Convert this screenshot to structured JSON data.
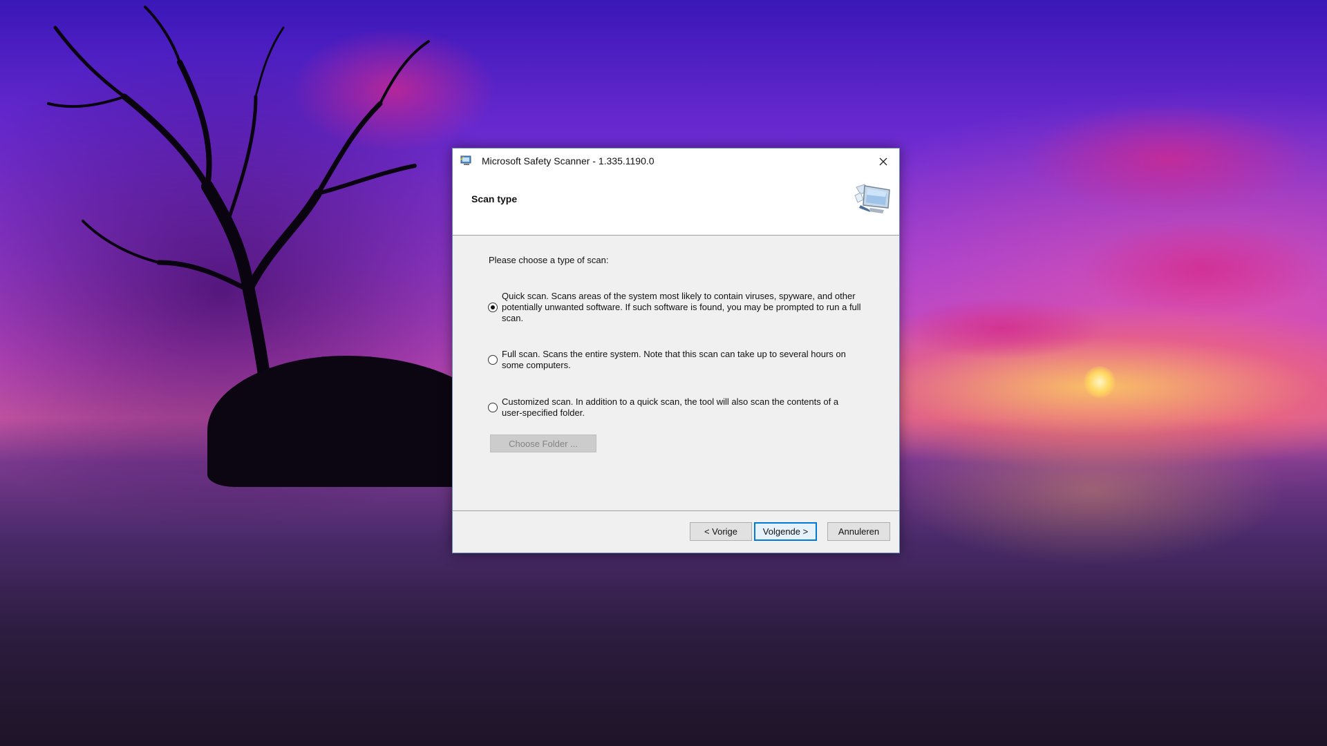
{
  "window": {
    "title": "Microsoft Safety Scanner - 1.335.1190.0",
    "icon": "scanner-app-icon",
    "close_icon": "close-icon"
  },
  "header": {
    "title": "Scan type",
    "icon": "monitor-scan-icon"
  },
  "body": {
    "prompt": "Please choose a type of scan:",
    "options": [
      {
        "label": "Quick scan. Scans areas of the system most likely to contain viruses, spyware, and other potentially unwanted software. If such software is found, you may be prompted to run a full scan.",
        "selected": true
      },
      {
        "label": "Full scan. Scans the entire system. Note that this scan can take up to several hours on some computers.",
        "selected": false
      },
      {
        "label": "Customized scan. In addition to a quick scan, the tool will also scan the contents of a user-specified folder.",
        "selected": false
      }
    ],
    "choose_folder_label": "Choose Folder ..."
  },
  "footer": {
    "back_label": "< Vorige",
    "next_label": "Volgende >",
    "cancel_label": "Annuleren"
  },
  "colors": {
    "accent": "#0078d7",
    "dialog_bg": "#f0f0f0"
  }
}
